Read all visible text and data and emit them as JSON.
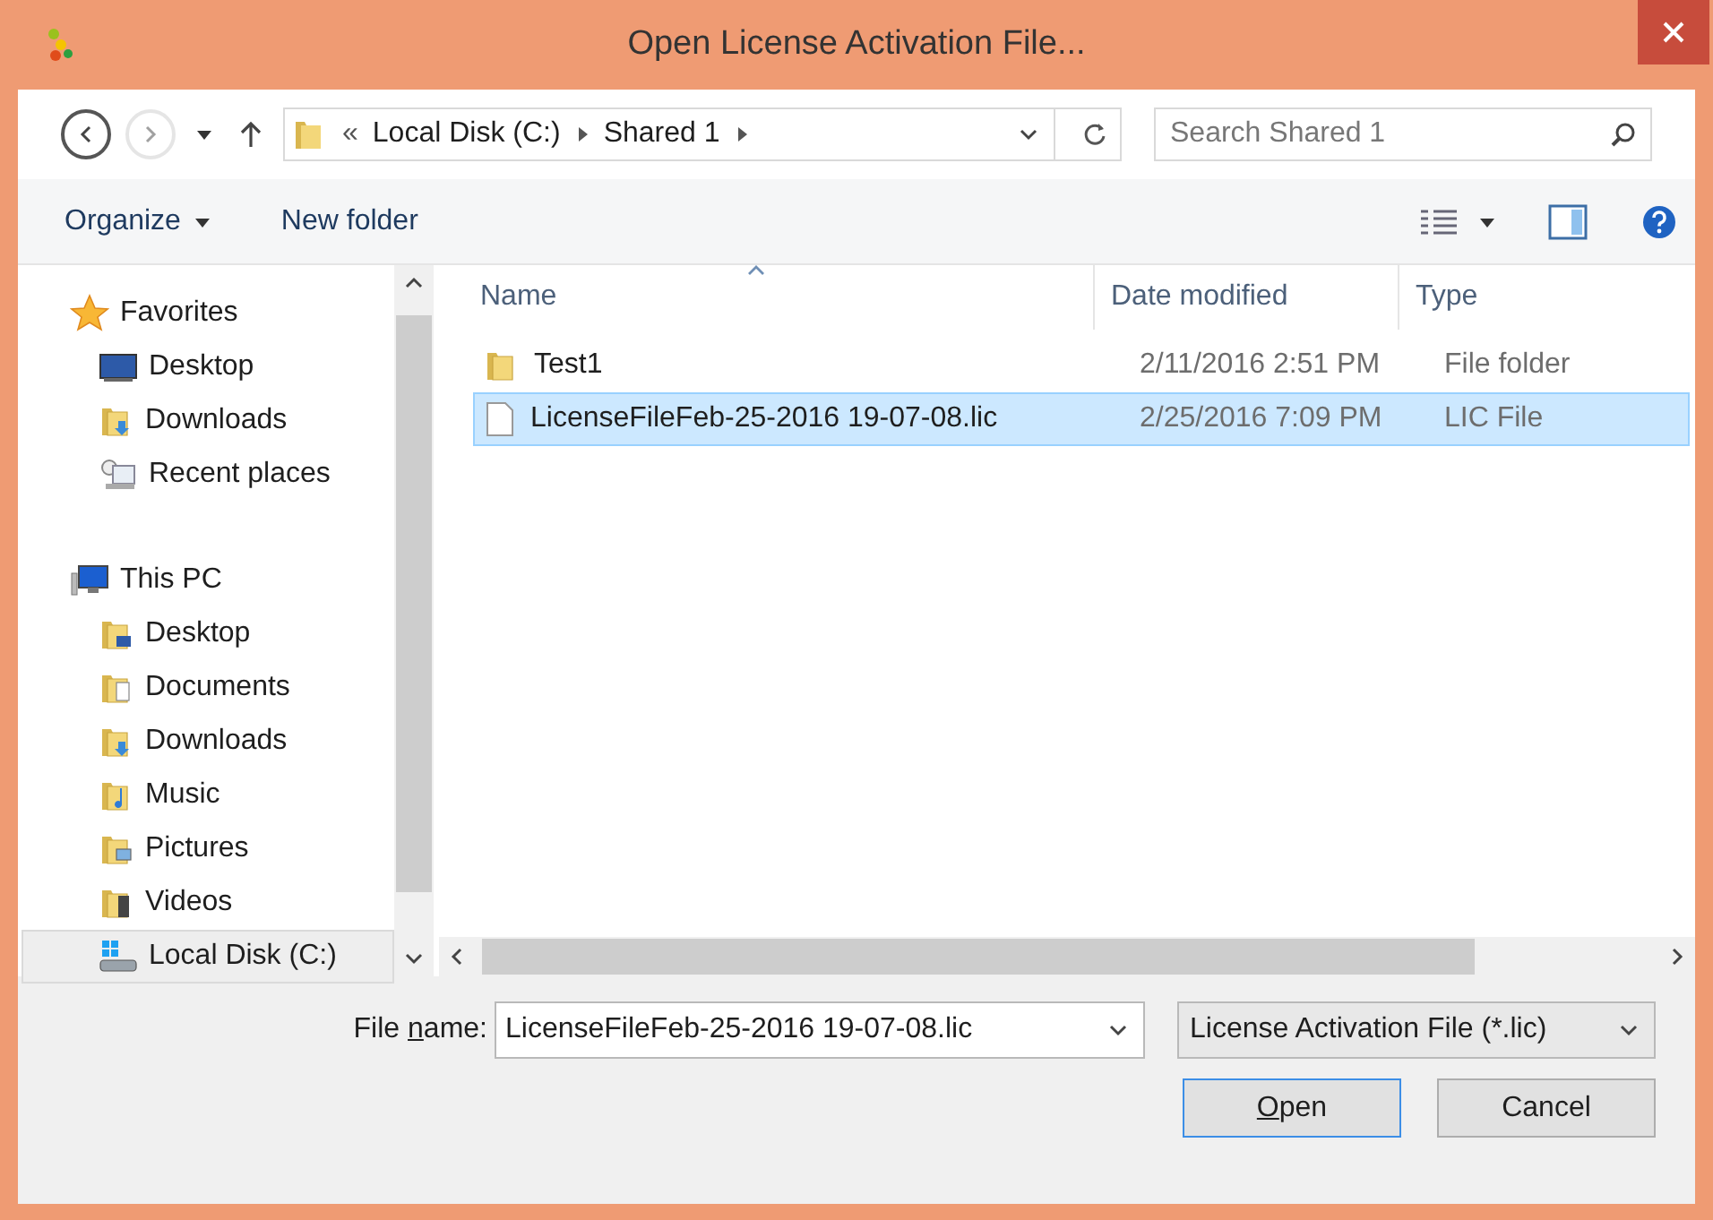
{
  "window": {
    "title": "Open License Activation File..."
  },
  "address": {
    "crumbs": [
      "Local Disk (C:)",
      "Shared 1"
    ],
    "overflow": "«"
  },
  "search": {
    "placeholder": "Search Shared 1"
  },
  "toolbar": {
    "organize": "Organize",
    "new_folder": "New folder"
  },
  "sidebar": [
    {
      "label": "Favorites",
      "kind": "star",
      "selected": false,
      "children": [
        {
          "label": "Desktop",
          "kind": "desktop",
          "selected": false
        },
        {
          "label": "Downloads",
          "kind": "downloads",
          "selected": false
        },
        {
          "label": "Recent places",
          "kind": "recent",
          "selected": false
        }
      ]
    },
    {
      "label": "This PC",
      "kind": "pc",
      "selected": false,
      "children": [
        {
          "label": "Desktop",
          "kind": "desktop-folder",
          "selected": false
        },
        {
          "label": "Documents",
          "kind": "documents",
          "selected": false
        },
        {
          "label": "Downloads",
          "kind": "downloads",
          "selected": false
        },
        {
          "label": "Music",
          "kind": "music",
          "selected": false
        },
        {
          "label": "Pictures",
          "kind": "pictures",
          "selected": false
        },
        {
          "label": "Videos",
          "kind": "videos",
          "selected": false
        },
        {
          "label": "Local Disk (C:)",
          "kind": "drive",
          "selected": true
        }
      ]
    }
  ],
  "columns": [
    "Name",
    "Date modified",
    "Type"
  ],
  "files": [
    {
      "name": "Test1",
      "date": "2/11/2016 2:51 PM",
      "type": "File folder",
      "kind": "folder",
      "selected": false
    },
    {
      "name": "LicenseFileFeb-25-2016 19-07-08.lic",
      "date": "2/25/2016 7:09 PM",
      "type": "LIC File",
      "kind": "file",
      "selected": true
    }
  ],
  "file_name": {
    "label_before": "File ",
    "label_key": "n",
    "label_after": "ame:",
    "value": "LicenseFileFeb-25-2016 19-07-08.lic"
  },
  "filter": {
    "value": "License Activation File (*.lic)"
  },
  "buttons": [
    {
      "key": "O",
      "rest": "pen",
      "default": true
    },
    {
      "rest": "Cancel",
      "default": false
    }
  ]
}
